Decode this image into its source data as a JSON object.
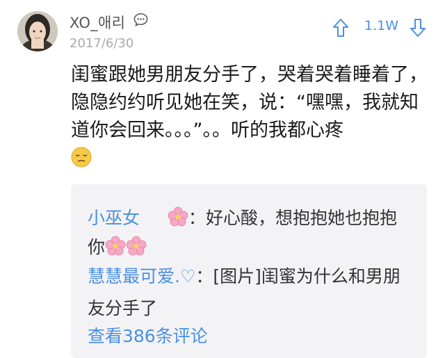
{
  "post": {
    "username": "XO_애리",
    "date": "2017/6/30",
    "votes": "1.1W",
    "body": "闺蜜跟她男朋友分手了，哭着哭着睡着了，隐隐约约听见她在笑，说：“嘿嘿，我就知道你会回来。。。”。。听的我都心疼"
  },
  "icons": {
    "chat": "chat-bubble-icon",
    "up": "upvote-arrow-icon",
    "down": "downvote-arrow-icon",
    "pensive": "pensive-face-emoji",
    "flower": "cherry-blossom-emoji"
  },
  "comments": {
    "c1_user": "小巫女",
    "c1_sep": "：",
    "c1_text_a": "好心酸，想抱抱她也抱抱",
    "c1_text_b": "你",
    "c2_user": "慧慧最可爱.♡",
    "c2_sep": "：",
    "c2_text_a": "[图片]闺蜜为什么和男朋",
    "c2_text_b": "友分手了",
    "view_all": "查看386条评论"
  },
  "colors": {
    "accent": "#4a90e2",
    "text": "#1a1a1a",
    "muted": "#aaaaaa",
    "comment_bg": "#f3f3f5"
  }
}
